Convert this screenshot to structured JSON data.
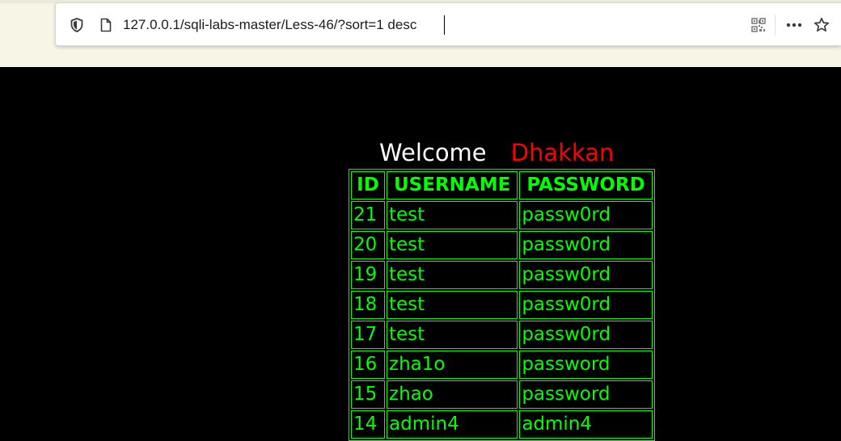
{
  "browser": {
    "url": "127.0.0.1/sqli-labs-master/Less-46/?sort=1 desc",
    "icons": [
      "shield-icon",
      "page-icon",
      "qr-code-icon",
      "more-icon",
      "star-icon"
    ]
  },
  "page": {
    "welcome": "Welcome",
    "user": "Dhakkan",
    "colors": {
      "background": "#000000",
      "table": "#00ff00",
      "welcome": "#ffffff",
      "user": "#ff0000"
    },
    "table": {
      "headers": [
        "ID",
        "USERNAME",
        "PASSWORD"
      ],
      "rows": [
        [
          "21",
          "test",
          "passw0rd"
        ],
        [
          "20",
          "test",
          "passw0rd"
        ],
        [
          "19",
          "test",
          "passw0rd"
        ],
        [
          "18",
          "test",
          "passw0rd"
        ],
        [
          "17",
          "test",
          "passw0rd"
        ],
        [
          "16",
          "zha1o",
          "password"
        ],
        [
          "15",
          "zhao",
          "password"
        ],
        [
          "14",
          "admin4",
          "admin4"
        ]
      ]
    }
  }
}
